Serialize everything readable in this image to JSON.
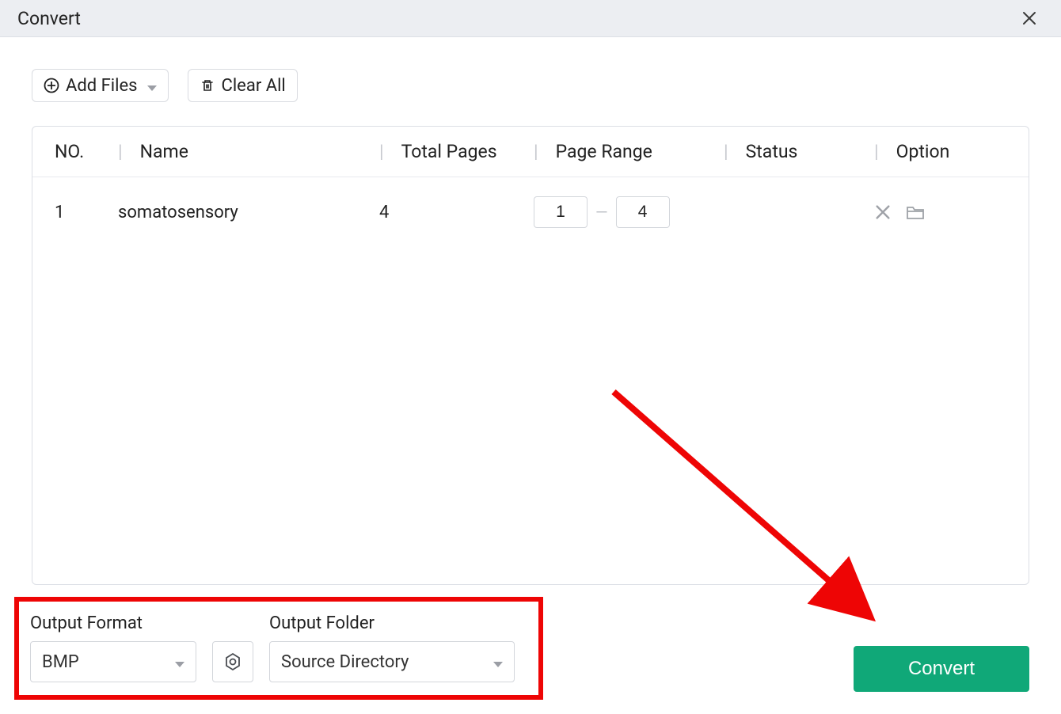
{
  "window": {
    "title": "Convert"
  },
  "toolbar": {
    "add_files_label": "Add Files",
    "clear_all_label": "Clear All"
  },
  "table": {
    "columns": {
      "no": "NO.",
      "name": "Name",
      "total_pages": "Total Pages",
      "page_range": "Page Range",
      "status": "Status",
      "option": "Option"
    },
    "rows": [
      {
        "no": "1",
        "name": "somatosensory",
        "total_pages": "4",
        "range_from": "1",
        "range_to": "4",
        "status": ""
      }
    ]
  },
  "output": {
    "format_label": "Output Format",
    "format_value": "BMP",
    "folder_label": "Output Folder",
    "folder_value": "Source Directory"
  },
  "actions": {
    "convert_label": "Convert"
  }
}
